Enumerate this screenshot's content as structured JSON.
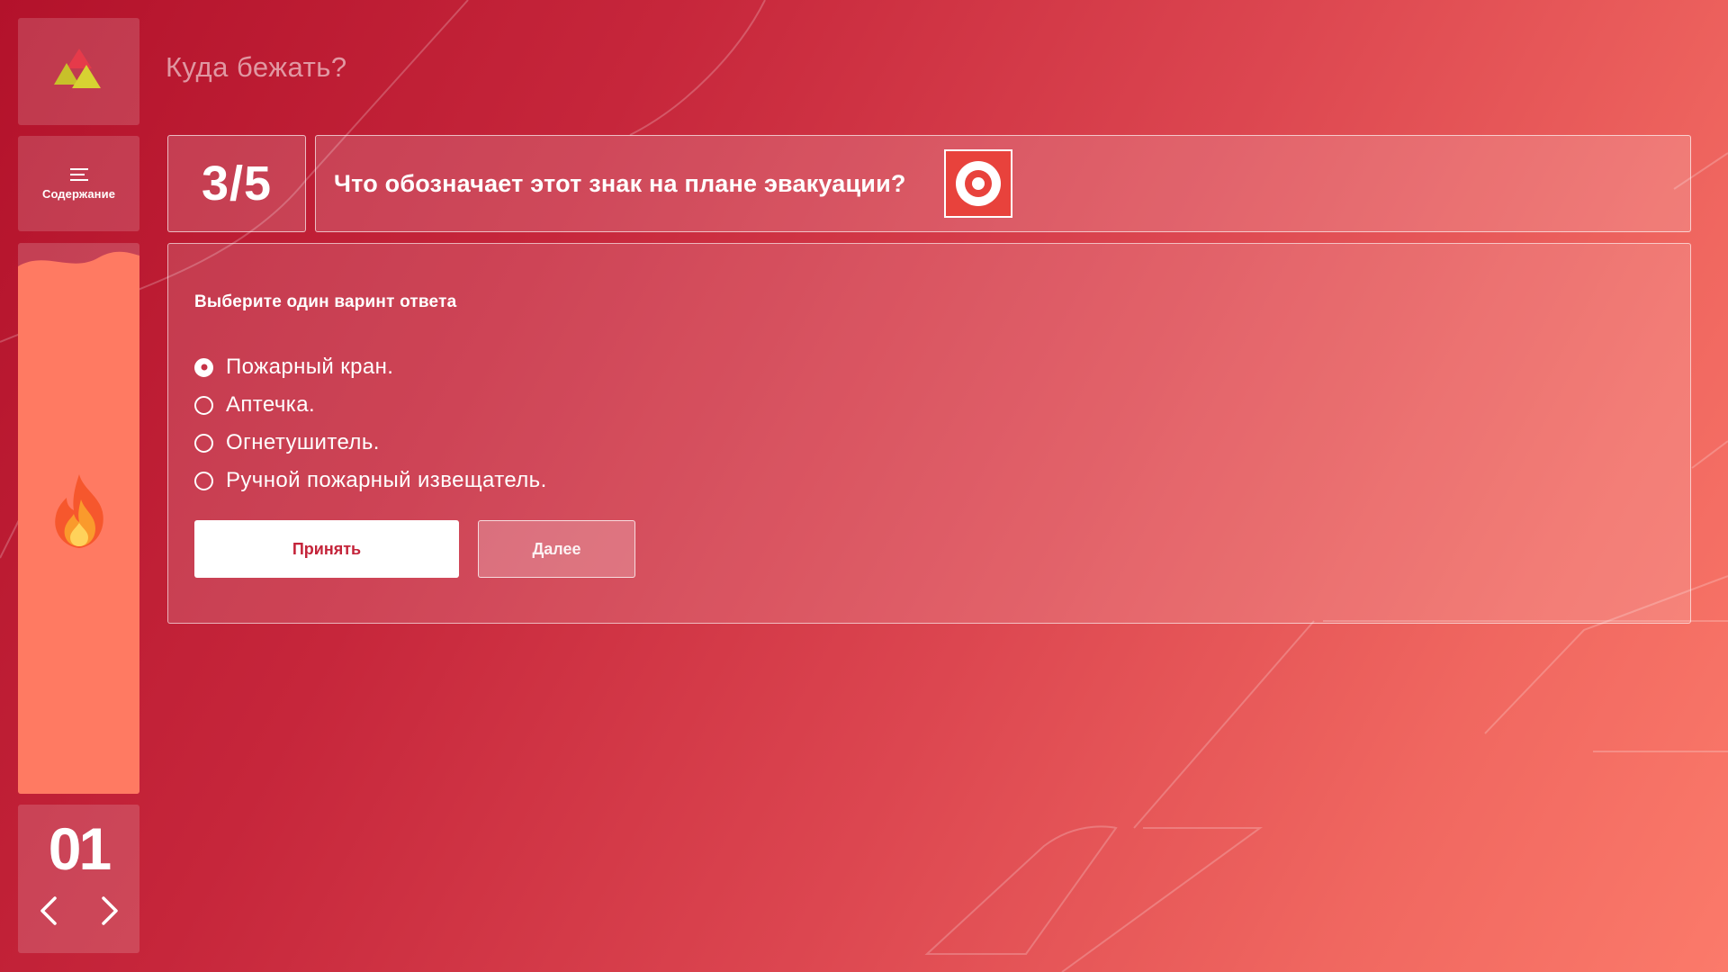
{
  "header": {
    "title": "Куда бежать?"
  },
  "sidebar": {
    "logo_icon": "triangles-logo-icon",
    "contents_label": "Содержание",
    "contents_icon": "menu-lines-icon",
    "progress_icon": "flame-icon",
    "slide_number": "01",
    "prev_icon": "chevron-left-icon",
    "next_icon": "chevron-right-icon"
  },
  "question": {
    "counter": "3/5",
    "text": "Что обозначает этот знак на плане эвакуации?",
    "sign_icon": "fire-alarm-button-sign-icon"
  },
  "answers": {
    "instruction": "Выберите один варинт ответа",
    "options": [
      {
        "label": "Пожарный кран.",
        "selected": true
      },
      {
        "label": "Аптечка.",
        "selected": false
      },
      {
        "label": "Огнетушитель.",
        "selected": false
      },
      {
        "label": "Ручной пожарный извещатель.",
        "selected": false
      }
    ],
    "accept_label": "Принять",
    "next_label": "Далее"
  },
  "colors": {
    "background_start": "#b3122b",
    "background_end": "#fb7a6a",
    "progress_fill": "#ff7a62",
    "accent_text": "#c4243a",
    "sign_red": "#e8423c"
  }
}
